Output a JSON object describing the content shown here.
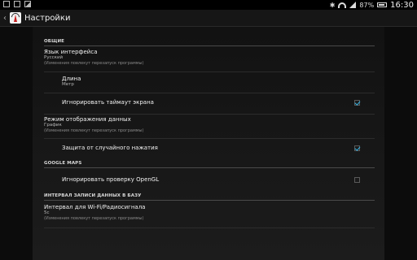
{
  "status_bar": {
    "battery": "87%",
    "time": "16:30"
  },
  "action_bar": {
    "title": "Настройки"
  },
  "sections": {
    "general": "ОБЩИЕ",
    "google_maps": "GOOGLE MAPS",
    "interval": "ИНТЕРВАЛ ЗАПИСИ ДАННЫХ В БАЗУ"
  },
  "items": {
    "language": {
      "title": "Язык интерфейса",
      "value": "Русский",
      "note": "(Изменения повлекут перезапуск программы)"
    },
    "length": {
      "title": "Длина",
      "value": "Метр"
    },
    "screen_timeout": {
      "title": "Игнорировать таймаут экрана",
      "checked": true
    },
    "display_mode": {
      "title": "Режим отображения данных",
      "value": "График",
      "note": "(Изменения повлекут перезапуск программы)"
    },
    "accidental_press": {
      "title": "Защита от случайного нажатия",
      "checked": true
    },
    "opengl": {
      "title": "Игнорировать проверку OpenGL",
      "checked": false
    },
    "wifi_interval": {
      "title": "Интервал для Wi-Fi/Радиосигнала",
      "value": "5с",
      "note": "(Изменения повлекут перезапуск программы)"
    }
  }
}
